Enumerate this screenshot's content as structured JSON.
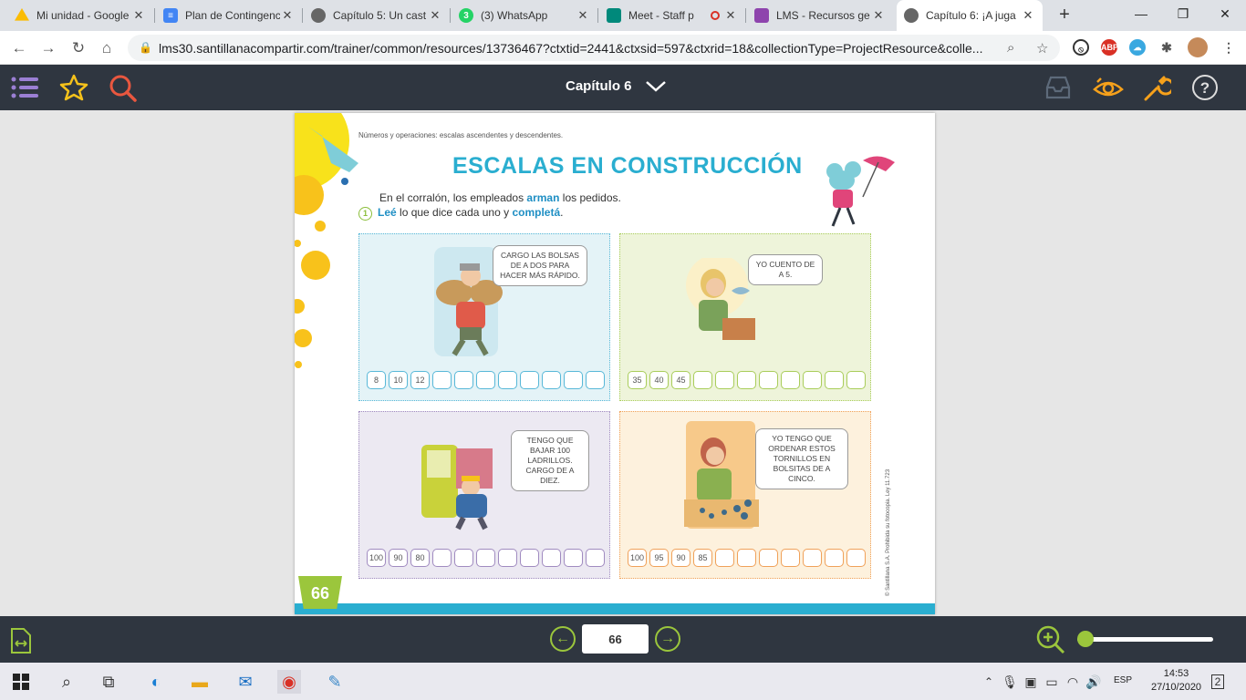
{
  "browser": {
    "tabs": [
      {
        "title": "Mi unidad - Google",
        "icon": "drive-icon",
        "color": "#1fa463"
      },
      {
        "title": "Plan de Contingencia",
        "icon": "docs-icon",
        "color": "#4285f4"
      },
      {
        "title": "Capítulo 5: Un cast",
        "icon": "globe-icon",
        "color": "#555555"
      },
      {
        "title": "(3) WhatsApp",
        "icon": "whatsapp-icon",
        "color": "#25d366",
        "badge": "3"
      },
      {
        "title": "Meet - Staff p",
        "icon": "meet-icon",
        "color": "#00897b"
      },
      {
        "title": "LMS - Recursos ge",
        "icon": "lms-icon",
        "color": "#8e44ad"
      },
      {
        "title": "Capítulo 6: ¡A juga",
        "icon": "globe-icon",
        "color": "#555555",
        "active": true
      }
    ],
    "url": "lms30.santillanacompartir.com/trainer/common/resources/13736467?ctxtid=2441&ctxsid=597&ctxrid=18&collectionType=ProjectResource&colle..."
  },
  "app": {
    "chapter_title": "Capítulo 6",
    "accent": "#9bc63c"
  },
  "page": {
    "subtitle": "Números y operaciones: escalas ascendentes y descendentes.",
    "title": "ESCALAS EN CONSTRUCCIÓN",
    "intro_pre": "En el corralón, los empleados ",
    "intro_hl": "arman",
    "intro_post": " los pedidos.",
    "instr_num": "1",
    "instr_a": "Leé",
    "instr_b": " lo que dice cada uno y ",
    "instr_c": "completá",
    "instr_d": ".",
    "panels": [
      {
        "bubble": "Cargo las bolsas de a dos para hacer más rápido.",
        "values": [
          "8",
          "10",
          "12",
          "",
          "",
          "",
          "",
          "",
          "",
          "",
          ""
        ]
      },
      {
        "bubble": "Yo cuento de a 5.",
        "values": [
          "35",
          "40",
          "45",
          "",
          "",
          "",
          "",
          "",
          "",
          "",
          ""
        ]
      },
      {
        "bubble": "Tengo que bajar 100 ladrillos. Cargo de a diez.",
        "values": [
          "100",
          "90",
          "80",
          "",
          "",
          "",
          "",
          "",
          "",
          "",
          ""
        ]
      },
      {
        "bubble": "Yo tengo que ordenar estos tornillos en bolsitas de a cinco.",
        "values": [
          "100",
          "95",
          "90",
          "85",
          "",
          "",
          "",
          "",
          "",
          "",
          ""
        ]
      }
    ],
    "page_number": "66",
    "copyright": "© Santillana S.A. Prohibida su fotocopia. Ley 11.723"
  },
  "footer": {
    "current_page": "66"
  },
  "taskbar": {
    "language": "ESP",
    "time": "14:53",
    "date": "27/10/2020",
    "notifications": "2"
  }
}
